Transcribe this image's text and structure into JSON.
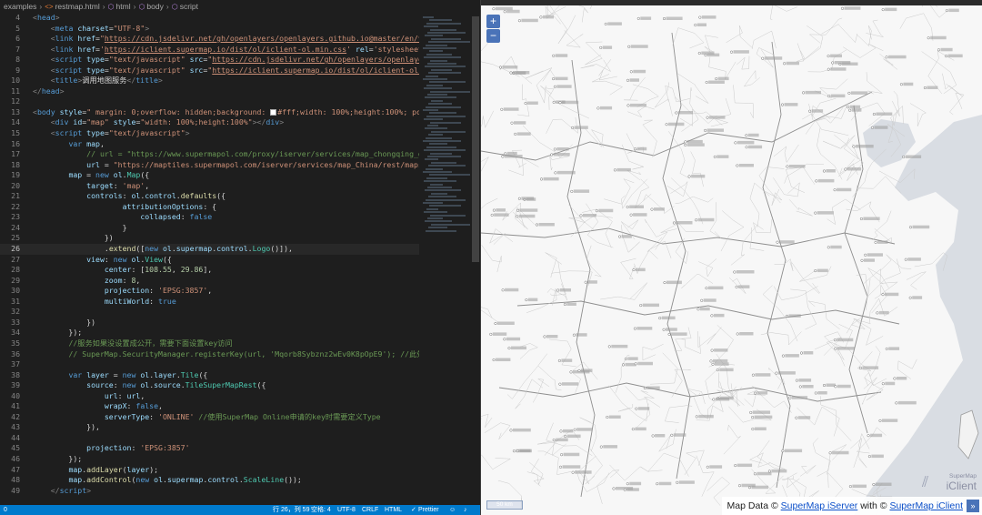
{
  "breadcrumb": {
    "root": "examples",
    "file": "restmap.html",
    "node1": "html",
    "node2": "body",
    "node3": "script"
  },
  "code_lines": [
    {
      "n": "4",
      "h": "<span class=\"p\">&lt;</span><span class=\"t\">head</span><span class=\"p\">&gt;</span>"
    },
    {
      "n": "5",
      "h": "    <span class=\"p\">&lt;</span><span class=\"t\">meta</span> <span class=\"a\">charset</span>=<span class=\"s\">\"UTF-8\"</span><span class=\"p\">&gt;</span>"
    },
    {
      "n": "6",
      "h": "    <span class=\"p\">&lt;</span><span class=\"t\">link</span> <span class=\"a\">href</span>=<span class=\"s\">\"</span><span class=\"u\">https://cdn.jsdelivr.net/gh/openlayers/openlayers.github.io@master/en/v6</span>"
    },
    {
      "n": "7",
      "h": "    <span class=\"p\">&lt;</span><span class=\"t\">link</span> <span class=\"a\">href</span>=<span class=\"s\">'</span><span class=\"u\">https://iclient.supermap.io/dist/ol/iclient-ol.min.css</span><span class=\"s\">'</span> <span class=\"a\">rel</span>=<span class=\"s\">'stylesheet'</span>"
    },
    {
      "n": "8",
      "h": "    <span class=\"p\">&lt;</span><span class=\"t\">script</span> <span class=\"a\">type</span>=<span class=\"s\">\"text/javascript\"</span> <span class=\"a\">src</span>=<span class=\"s\">\"</span><span class=\"u\">https://cdn.jsdelivr.net/gh/openlayers/openlayer</span>"
    },
    {
      "n": "9",
      "h": "    <span class=\"p\">&lt;</span><span class=\"t\">script</span> <span class=\"a\">type</span>=<span class=\"s\">\"text/javascript\"</span> <span class=\"a\">src</span>=<span class=\"s\">\"</span><span class=\"u\">https://iclient.supermap.io/dist/ol/iclient-ol.m</span>"
    },
    {
      "n": "10",
      "h": "    <span class=\"p\">&lt;</span><span class=\"t\">title</span><span class=\"p\">&gt;</span>调用地图服务<span class=\"p\">&lt;/</span><span class=\"t\">title</span><span class=\"p\">&gt;</span>"
    },
    {
      "n": "11",
      "h": "<span class=\"p\">&lt;/</span><span class=\"t\">head</span><span class=\"p\">&gt;</span>"
    },
    {
      "n": "12",
      "h": ""
    },
    {
      "n": "13",
      "h": "<span class=\"p\">&lt;</span><span class=\"t\">body</span> <span class=\"a\">style</span>=<span class=\"s\">\" margin: 0;overflow: hidden;background: <span class=\"swatch\"></span>#fff;width: 100%;height:100%; pos</span>"
    },
    {
      "n": "14",
      "h": "    <span class=\"p\">&lt;</span><span class=\"t\">div</span> <span class=\"a\">id</span>=<span class=\"s\">\"map\"</span> <span class=\"a\">style</span>=<span class=\"s\">\"width: 100%;height:100%\"</span><span class=\"p\">&gt;&lt;/</span><span class=\"t\">div</span><span class=\"p\">&gt;</span>"
    },
    {
      "n": "15",
      "h": "    <span class=\"p\">&lt;</span><span class=\"t\">script</span> <span class=\"a\">type</span>=<span class=\"s\">\"text/javascript\"</span><span class=\"p\">&gt;</span>"
    },
    {
      "n": "16",
      "h": "        <span class=\"k\">var</span> <span class=\"v\">map</span>,"
    },
    {
      "n": "17",
      "h": "            <span class=\"c\">// url = \"https://www.supermapol.com/proxy/iserver/services/map_chongqing_gy</span>"
    },
    {
      "n": "18",
      "h": "            <span class=\"v\">url</span> = <span class=\"s\">\"https://maptiles.supermapol.com/iserver/services/map_China/rest/maps/C</span>"
    },
    {
      "n": "19",
      "h": "        <span class=\"v\">map</span> = <span class=\"k\">new</span> <span class=\"v\">ol</span>.<span class=\"ct\">Map</span>({"
    },
    {
      "n": "20",
      "h": "            <span class=\"v\">target</span>: <span class=\"s\">'map'</span>,"
    },
    {
      "n": "21",
      "h": "            <span class=\"v\">controls</span>: <span class=\"v\">ol</span>.<span class=\"v\">control</span>.<span class=\"f\">defaults</span>({"
    },
    {
      "n": "22",
      "h": "                    <span class=\"v\">attributionOptions</span>: {"
    },
    {
      "n": "23",
      "h": "                        <span class=\"v\">collapsed</span>: <span class=\"k\">false</span>"
    },
    {
      "n": "24",
      "h": "                    }"
    },
    {
      "n": "25",
      "h": "                })"
    },
    {
      "n": "26",
      "h": "                .<span class=\"f\">extend</span>([<span class=\"k\">new</span> <span class=\"v\">ol</span>.<span class=\"v\">supermap</span>.<span class=\"v\">control</span>.<span class=\"ct\">Logo</span>()]),"
    },
    {
      "n": "27",
      "h": "            <span class=\"v\">view</span>: <span class=\"k\">new</span> <span class=\"v\">ol</span>.<span class=\"ct\">View</span>({"
    },
    {
      "n": "28",
      "h": "                <span class=\"v\">center</span>: [<span class=\"n\">108.55</span>, <span class=\"n\">29.86</span>],"
    },
    {
      "n": "29",
      "h": "                <span class=\"v\">zoom</span>: <span class=\"n\">8</span>,"
    },
    {
      "n": "30",
      "h": "                <span class=\"v\">projection</span>: <span class=\"s\">'EPSG:3857'</span>,"
    },
    {
      "n": "31",
      "h": "                <span class=\"v\">multiWorld</span>: <span class=\"k\">true</span>"
    },
    {
      "n": "32",
      "h": ""
    },
    {
      "n": "33",
      "h": "            })"
    },
    {
      "n": "34",
      "h": "        });"
    },
    {
      "n": "35",
      "h": "        <span class=\"c\">//服务如果没设置成公开，需要下面设置key访问</span>"
    },
    {
      "n": "36",
      "h": "        <span class=\"c\">// SuperMap.SecurityManager.registerKey(url, 'Mqorb8Sybznz2wEv0K8pOpE9'); //此处</span>"
    },
    {
      "n": "37",
      "h": ""
    },
    {
      "n": "38",
      "h": "        <span class=\"k\">var</span> <span class=\"v\">layer</span> = <span class=\"k\">new</span> <span class=\"v\">ol</span>.<span class=\"v\">layer</span>.<span class=\"ct\">Tile</span>({"
    },
    {
      "n": "39",
      "h": "            <span class=\"v\">source</span>: <span class=\"k\">new</span> <span class=\"v\">ol</span>.<span class=\"v\">source</span>.<span class=\"ct\">TileSuperMapRest</span>({"
    },
    {
      "n": "40",
      "h": "                <span class=\"v\">url</span>: <span class=\"v\">url</span>,"
    },
    {
      "n": "41",
      "h": "                <span class=\"v\">wrapX</span>: <span class=\"k\">false</span>,"
    },
    {
      "n": "42",
      "h": "                <span class=\"v\">serverType</span>: <span class=\"s\">'ONLINE'</span> <span class=\"c\">//使用SuperMap Online申请的key时需要定义Type</span>"
    },
    {
      "n": "43",
      "h": "            }),"
    },
    {
      "n": "44",
      "h": ""
    },
    {
      "n": "45",
      "h": "            <span class=\"v\">projection</span>: <span class=\"s\">'EPSG:3857'</span>"
    },
    {
      "n": "46",
      "h": "        });"
    },
    {
      "n": "47",
      "h": "        <span class=\"v\">map</span>.<span class=\"f\">addLayer</span>(<span class=\"v\">layer</span>);"
    },
    {
      "n": "48",
      "h": "        <span class=\"v\">map</span>.<span class=\"f\">addControl</span>(<span class=\"k\">new</span> <span class=\"v\">ol</span>.<span class=\"v\">supermap</span>.<span class=\"v\">control</span>.<span class=\"ct\">ScaleLine</span>());"
    },
    {
      "n": "49",
      "h": "    <span class=\"p\">&lt;/</span><span class=\"t\">script</span><span class=\"p\">&gt;</span>"
    }
  ],
  "cursor_line": "26",
  "status": {
    "left": "0",
    "position": "行 26，列 59",
    "spaces": "空格: 4",
    "encoding": "UTF-8",
    "eol": "CRLF",
    "language": "HTML",
    "prettier": "Prettier"
  },
  "map": {
    "zoom_in": "+",
    "zoom_out": "−",
    "attribution_prefix": "Map Data ©",
    "attribution_link1": "SuperMap iServer",
    "attribution_mid": "with ©",
    "attribution_link2": "SuperMap iClient",
    "attribution_toggle": "»",
    "logo_small": "SuperMap",
    "logo_main": "iClient",
    "scale_label": "50 km",
    "colors": {
      "land": "#f7f7f7",
      "sea": "#d9dde3",
      "border": "#8e8e8e",
      "road": "#c8c8c8"
    }
  }
}
